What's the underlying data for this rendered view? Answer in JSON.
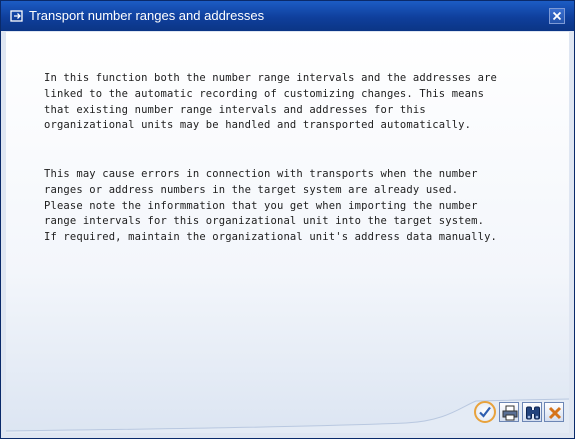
{
  "dialog": {
    "title": "Transport number ranges and addresses",
    "paragraph1": "In this function both the number range intervals and the addresses are\nlinked to the automatic recording of customizing changes. This means\nthat existing number range intervals and addresses for this\norganizational units may be handled and transported automatically.",
    "paragraph2": "This may cause errors in connection with transports when the number\nranges or address numbers in the target system are already used.\nPlease note the informmation that you get when importing the number\nrange intervals for this organizational unit into the target system.\nIf required, maintain the organizational unit's address data manually."
  },
  "toolbar": {
    "buttons": [
      {
        "icon": "checkmark-icon"
      },
      {
        "icon": "printer-icon"
      },
      {
        "icon": "binoculars-icon"
      },
      {
        "icon": "cancel-icon"
      }
    ]
  },
  "colors": {
    "titlebar": "#0f3f9c",
    "accent_highlight": "#e8a23c",
    "cancel": "#d5731a"
  }
}
